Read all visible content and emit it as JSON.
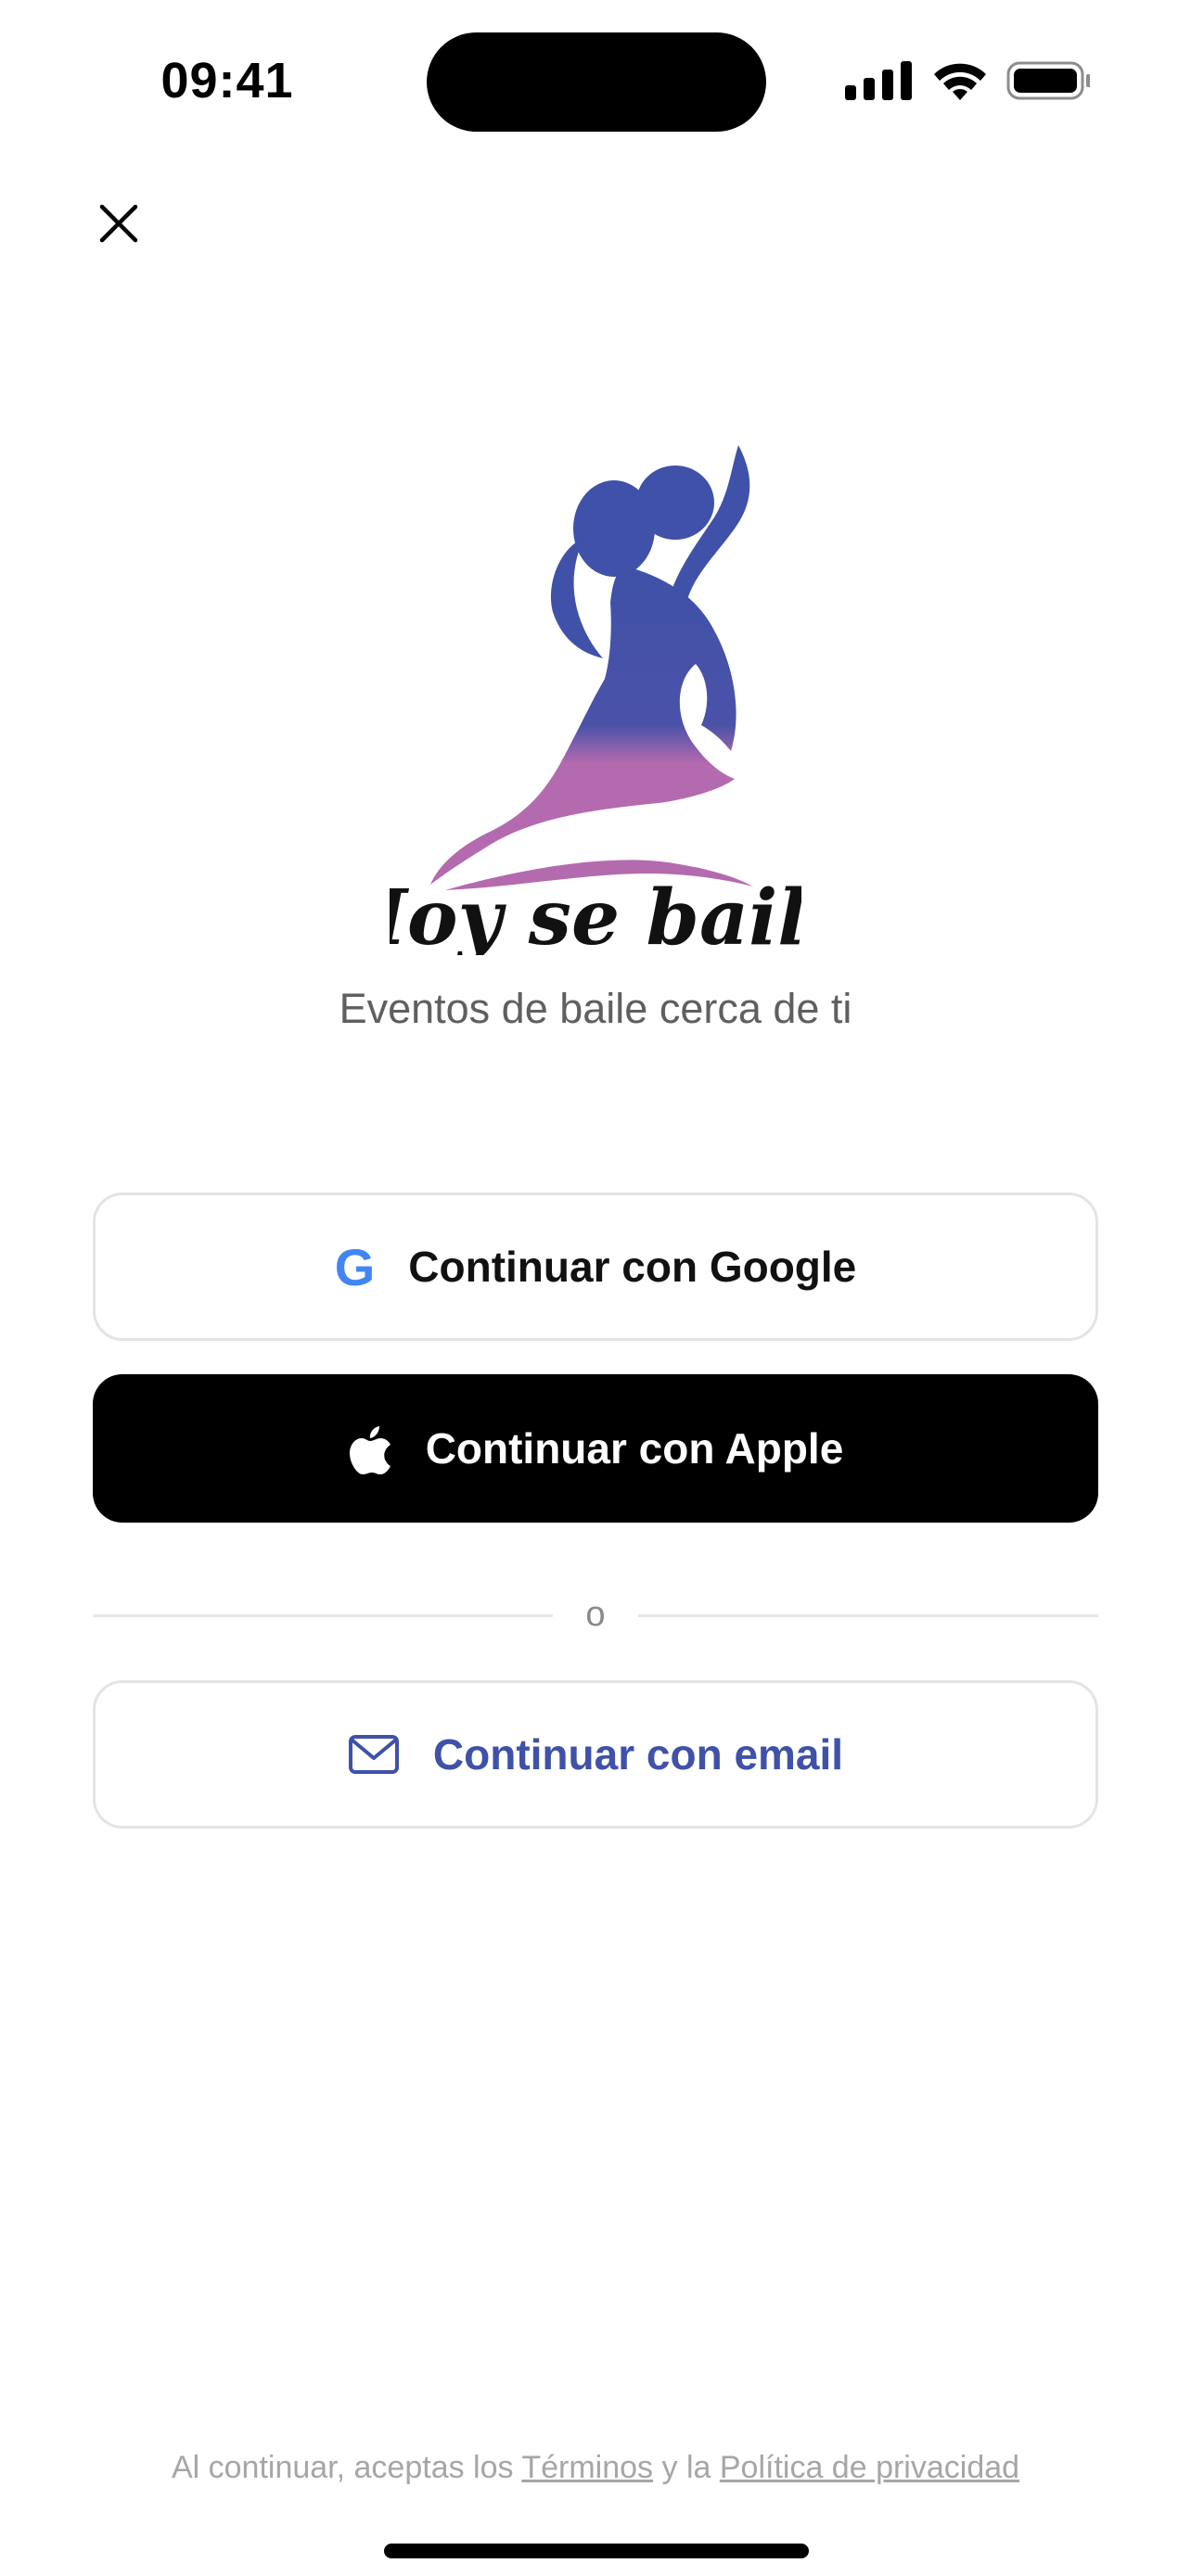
{
  "status_bar": {
    "time": "09:41"
  },
  "brand": {
    "name": "Hoy se baila",
    "tagline": "Eventos de baile cerca de ti"
  },
  "auth": {
    "google_label": "Continuar con Google",
    "google_icon_glyph": "G",
    "apple_label": "Continuar con Apple",
    "divider_text": "o",
    "email_label": "Continuar con email"
  },
  "legal": {
    "prefix": "Al continuar, aceptas los ",
    "terms_link": "Términos",
    "connector": " y la ",
    "privacy_link": "Política de privacidad"
  },
  "colors": {
    "accent": "#3F51A8",
    "google_blue": "#4285F4",
    "logo_purple": "#B46AAE"
  },
  "icons": {
    "close": "close-icon",
    "google": "google-icon",
    "apple": "apple-icon",
    "email": "mail-icon"
  }
}
